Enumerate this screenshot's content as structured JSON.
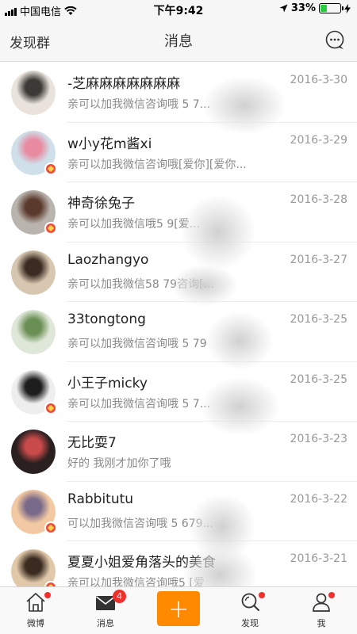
{
  "status_bar": {
    "carrier": "中国电信",
    "time": "下午9:42",
    "battery": "33%",
    "battery_level": 0.33
  },
  "nav": {
    "left_label": "发现群",
    "title": "消息",
    "right_icon": "chat-bubble-icon"
  },
  "messages": [
    {
      "name": "-芝麻麻麻麻麻麻麻",
      "date": "2016-3-30",
      "preview": "亲可以加我微信咨询哦 5          7...",
      "verified": false,
      "avatar_colors": [
        "#e9e3dc",
        "#3c3a36"
      ]
    },
    {
      "name": "w小y花m酱xi",
      "date": "2016-3-29",
      "preview": "亲可以加我微信咨询哦[爱你][爱你...",
      "verified": true,
      "avatar_colors": [
        "#cfe0ea",
        "#e88aa0"
      ]
    },
    {
      "name": "神奇徐兔子",
      "date": "2016-3-28",
      "preview": "亲可以加我微信哦5           9[爱...",
      "verified": true,
      "avatar_colors": [
        "#b9b4ad",
        "#5b3a2e"
      ]
    },
    {
      "name": "Laozhangyo",
      "date": "2016-3-27",
      "preview": "亲可以加我微信58        79咨询[...",
      "verified": false,
      "avatar_colors": [
        "#d8c7b0",
        "#3b2b22"
      ]
    },
    {
      "name": "33tongtong",
      "date": "2016-3-25",
      "preview": "亲可以加我微信咨询哦 5        79",
      "verified": false,
      "avatar_colors": [
        "#dfe8d8",
        "#6a8f55"
      ]
    },
    {
      "name": "小王子micky",
      "date": "2016-3-25",
      "preview": "亲可以加我微信咨询哦 5         7...",
      "verified": true,
      "avatar_colors": [
        "#eeeeee",
        "#1e1e1e"
      ]
    },
    {
      "name": "无比耍7",
      "date": "2016-3-23",
      "preview": "好的 我刚才加你了哦",
      "verified": false,
      "avatar_colors": [
        "#2b2020",
        "#c94a4a"
      ]
    },
    {
      "name": "Rabbitutu",
      "date": "2016-3-22",
      "preview": "可以加我微信咨询哦 5        679...",
      "verified": true,
      "avatar_colors": [
        "#f2c9a2",
        "#7a6a8a"
      ]
    },
    {
      "name": "夏夏小姐爱角落头的美食",
      "date": "2016-3-21",
      "preview": "亲可以加我微信咨询哦5         [爱",
      "verified": true,
      "avatar_colors": [
        "#e0c8a8",
        "#3a2a20"
      ]
    }
  ],
  "tabs": [
    {
      "label": "微博",
      "icon": "home-icon",
      "dot": true
    },
    {
      "label": "消息",
      "icon": "envelope-icon",
      "badge": "4"
    },
    {
      "label": "",
      "icon": "plus-icon"
    },
    {
      "label": "发现",
      "icon": "search-icon",
      "dot": true
    },
    {
      "label": "我",
      "icon": "person-icon",
      "dot": true
    }
  ],
  "colors": {
    "accent_orange": "#ff8a00",
    "badge_red": "#f0302a",
    "verified_red": "#f04b3a"
  }
}
